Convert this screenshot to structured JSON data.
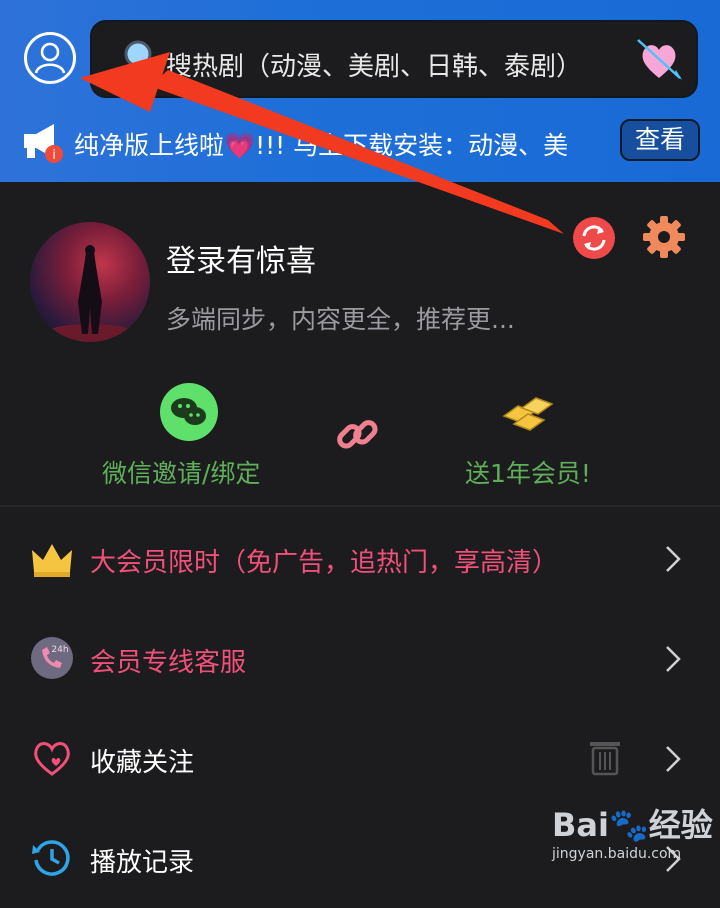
{
  "search": {
    "placeholder": "搜热剧（动漫、美剧、日韩、泰剧）"
  },
  "announcement": {
    "text": "纯净版上线啦💗!!! 马上下载安装：动漫、美",
    "button": "查看"
  },
  "profile": {
    "title": "登录有惊喜",
    "subtitle": "多端同步，内容更全，推荐更..."
  },
  "actions": {
    "wechat_label": "微信邀请/绑定",
    "gift_label": "送1年会员!"
  },
  "menu": [
    {
      "label": "大会员限时（免广告，追热门，享高清）",
      "color": "#f0507a",
      "icon": "crown-icon"
    },
    {
      "label": "会员专线客服",
      "color": "#f0507a",
      "icon": "phone-24h-icon"
    },
    {
      "label": "收藏关注",
      "color": "#ffffff",
      "icon": "heart-outline-icon"
    },
    {
      "label": "播放记录",
      "color": "#ffffff",
      "icon": "history-clock-icon"
    }
  ],
  "watermark": {
    "brand": "Bai🐾经验",
    "url": "jingyan.baidu.com"
  },
  "colors": {
    "header_blue": "#1f6fd8",
    "accent_pink": "#f0507a",
    "green": "#5fae5a",
    "arrow_red": "#f13a1f"
  }
}
